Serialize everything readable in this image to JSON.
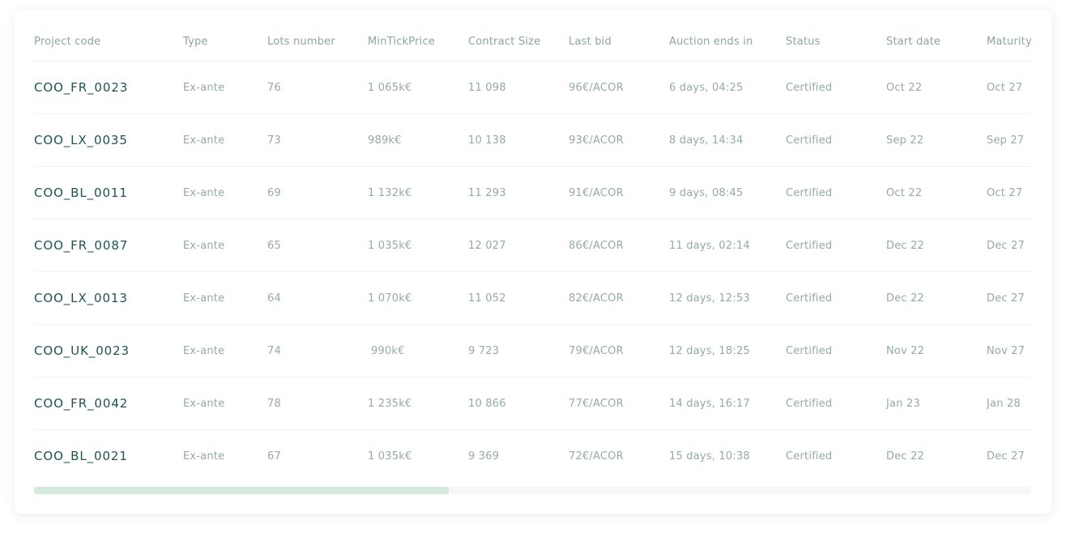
{
  "table": {
    "columns": [
      "Project code",
      "Type",
      "Lots number",
      "MinTickPrice",
      "Contract Size",
      "Last bid",
      "Auction ends in",
      "Status",
      "Start date",
      "Maturity"
    ],
    "rows": [
      [
        "COO_FR_0023",
        "Ex-ante",
        "76",
        "1 065k€",
        "11 098",
        "96€/ACOR",
        "6 days, 04:25",
        "Certified",
        "Oct 22",
        "Oct 27"
      ],
      [
        "COO_LX_0035",
        "Ex-ante",
        "73",
        "989k€",
        "10 138",
        "93€/ACOR",
        "8 days, 14:34",
        "Certified",
        "Sep 22",
        "Sep 27"
      ],
      [
        "COO_BL_0011",
        "Ex-ante",
        "69",
        "1 132k€",
        "11 293",
        "91€/ACOR",
        "9 days, 08:45",
        "Certified",
        "Oct 22",
        "Oct 27"
      ],
      [
        "COO_FR_0087",
        "Ex-ante",
        "65",
        "1 035k€",
        "12 027",
        "86€/ACOR",
        "11 days, 02:14",
        "Certified",
        "Dec 22",
        "Dec 27"
      ],
      [
        "COO_LX_0013",
        "Ex-ante",
        "64",
        "1 070k€",
        "11 052",
        "82€/ACOR",
        "12 days, 12:53",
        "Certified",
        "Dec 22",
        "Dec 27"
      ],
      [
        "COO_UK_0023",
        "Ex-ante",
        "74",
        "990k€",
        "9 723",
        "79€/ACOR",
        "12 days, 18:25",
        "Certified",
        "Nov 22",
        "Nov 27"
      ],
      [
        "COO_FR_0042",
        "Ex-ante",
        "78",
        "1 235k€",
        "10 866",
        "77€/ACOR",
        "14 days, 16:17",
        "Certified",
        "Jan 23",
        "Jan 28"
      ],
      [
        "COO_BL_0021",
        "Ex-ante",
        "67",
        "1 035k€",
        "9 369",
        "72€/ACOR",
        "15 days, 10:38",
        "Certified",
        "Dec 22",
        "Dec 27"
      ]
    ]
  },
  "scrollbar": {
    "position_fraction": 0.0,
    "visible_fraction": 0.416
  },
  "colors": {
    "project_code_text": "#1d5452",
    "muted_text": "#94aba5",
    "scroll_thumb": "#d4e8dc"
  }
}
